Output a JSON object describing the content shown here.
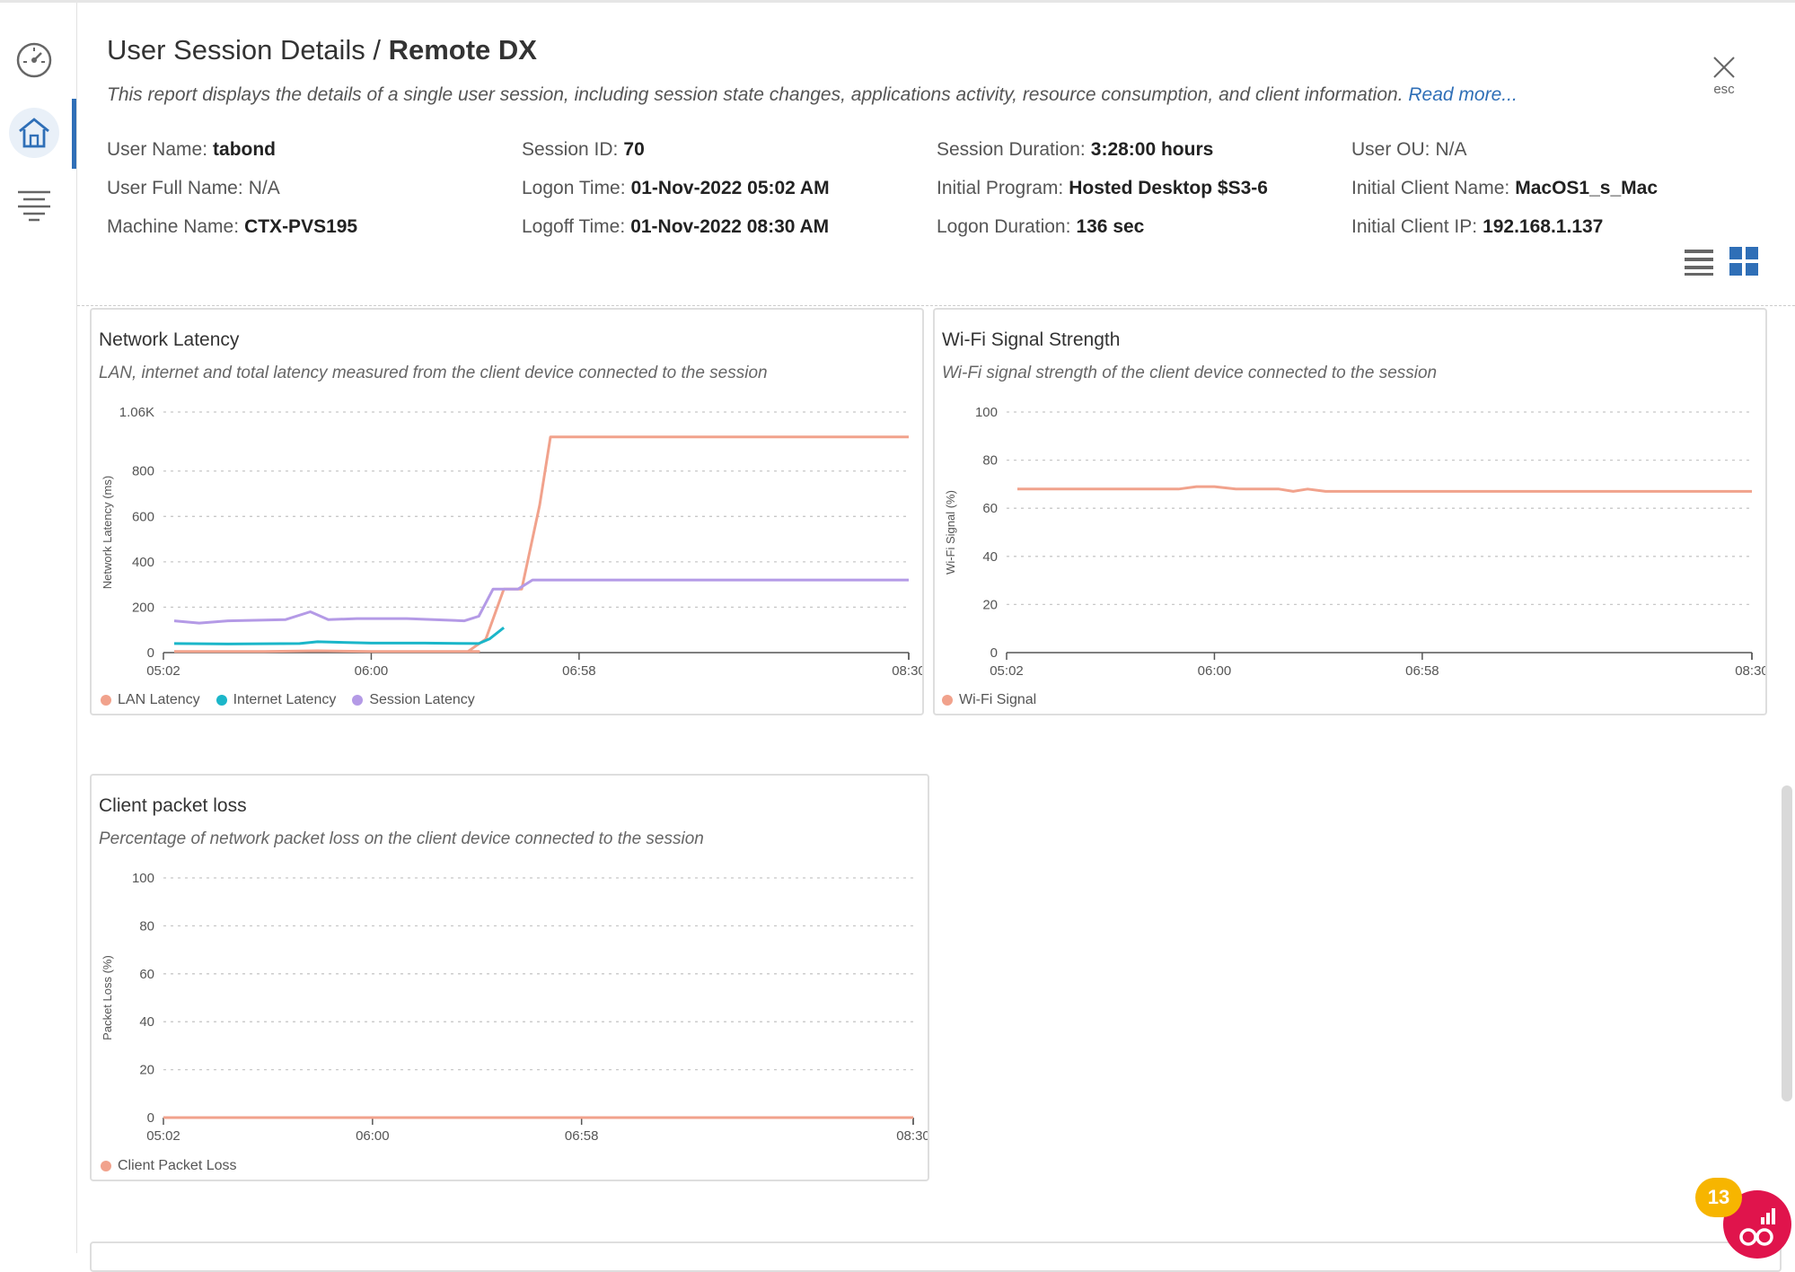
{
  "header": {
    "title_prefix": "User Session Details / ",
    "title_main": "Remote DX",
    "description": "This report displays the details of a single user session, including session state changes, applications activity, resource consumption, and client information.",
    "read_more": "Read more...",
    "close_label": "esc"
  },
  "session_info": [
    {
      "label": "User Name:",
      "value": "tabond"
    },
    {
      "label": "Session ID:",
      "value": "70"
    },
    {
      "label": "Session Duration:",
      "value": "3:28:00 hours"
    },
    {
      "label": "User OU:",
      "value": "N/A"
    },
    {
      "label": "User Full Name:",
      "value": "N/A"
    },
    {
      "label": "Logon Time:",
      "value": "01-Nov-2022 05:02 AM"
    },
    {
      "label": "Initial Program:",
      "value": "Hosted Desktop $S3-6"
    },
    {
      "label": "Initial Client Name:",
      "value": "MacOS1_s_Mac"
    },
    {
      "label": "Machine Name:",
      "value": "CTX-PVS195"
    },
    {
      "label": "Logoff Time:",
      "value": "01-Nov-2022 08:30 AM"
    },
    {
      "label": "Logon Duration:",
      "value": "136 sec"
    },
    {
      "label": "Initial Client IP:",
      "value": "192.168.1.137"
    }
  ],
  "sidebar": {
    "icons": [
      "dashboard-icon",
      "home-icon",
      "filter-list-icon"
    ],
    "active": "home-icon"
  },
  "view_toggle": {
    "icons": [
      "list-view-icon",
      "grid-view-icon"
    ],
    "active": "grid-view-icon"
  },
  "notifications": {
    "count": "13"
  },
  "colors": {
    "lan": "#f1a28c",
    "internet": "#1bb6c9",
    "session": "#b49ae6",
    "accent": "#2f6fb7",
    "badge": "#f7b500",
    "bubble": "#e0144c"
  },
  "charts": {
    "latency": {
      "title": "Network Latency",
      "subtitle": "LAN, internet and total latency measured from the client device connected to the session"
    },
    "wifi": {
      "title": "Wi-Fi Signal Strength",
      "subtitle": "Wi-Fi signal strength of the client device connected to the session"
    },
    "packet": {
      "title": "Client packet loss",
      "subtitle": "Percentage of network packet loss on the client device connected to the session"
    }
  },
  "chart_data": [
    {
      "type": "line",
      "title": "Network Latency",
      "ylabel": "Network Latency (ms)",
      "ylim": [
        0,
        1060
      ],
      "yticks": [
        0,
        200,
        400,
        600,
        800,
        1060
      ],
      "ytick_labels": [
        "0",
        "200",
        "400",
        "600",
        "800",
        "1.06K"
      ],
      "xlim": [
        302,
        510
      ],
      "xticks": [
        302,
        360,
        418,
        510
      ],
      "xtick_labels": [
        "05:02",
        "06:00",
        "06:58",
        "08:30"
      ],
      "grid": true,
      "legend": "bottom-left",
      "series": [
        {
          "name": "LAN Latency",
          "color": "#f1a28c",
          "points": [
            [
              305,
              5
            ],
            [
              330,
              5
            ],
            [
              345,
              8
            ],
            [
              360,
              5
            ],
            [
              390,
              5
            ],
            [
              387,
              5
            ],
            [
              392,
              60
            ],
            [
              397,
              280
            ],
            [
              402,
              280
            ],
            [
              407,
              650
            ],
            [
              410,
              950
            ],
            [
              510,
              950
            ]
          ]
        },
        {
          "name": "Internet Latency",
          "color": "#1bb6c9",
          "points": [
            [
              305,
              40
            ],
            [
              320,
              38
            ],
            [
              340,
              40
            ],
            [
              345,
              48
            ],
            [
              360,
              42
            ],
            [
              375,
              42
            ],
            [
              390,
              40
            ],
            [
              393,
              60
            ],
            [
              397,
              110
            ]
          ]
        },
        {
          "name": "Session Latency",
          "color": "#b49ae6",
          "points": [
            [
              305,
              140
            ],
            [
              312,
              130
            ],
            [
              320,
              140
            ],
            [
              336,
              145
            ],
            [
              343,
              180
            ],
            [
              348,
              145
            ],
            [
              356,
              150
            ],
            [
              370,
              150
            ],
            [
              386,
              140
            ],
            [
              390,
              160
            ],
            [
              394,
              280
            ],
            [
              401,
              280
            ],
            [
              405,
              320
            ],
            [
              510,
              320
            ]
          ]
        }
      ]
    },
    {
      "type": "line",
      "title": "Wi-Fi Signal Strength",
      "ylabel": "Wi-Fi Signal (%)",
      "ylim": [
        0,
        100
      ],
      "yticks": [
        0,
        20,
        40,
        60,
        80,
        100
      ],
      "ytick_labels": [
        "0",
        "20",
        "40",
        "60",
        "80",
        "100"
      ],
      "xlim": [
        302,
        510
      ],
      "xticks": [
        302,
        360,
        418,
        510
      ],
      "xtick_labels": [
        "05:02",
        "06:00",
        "06:58",
        "08:30"
      ],
      "grid": true,
      "legend": "bottom-left",
      "series": [
        {
          "name": "Wi-Fi Signal",
          "color": "#f1a28c",
          "points": [
            [
              305,
              68
            ],
            [
              350,
              68
            ],
            [
              355,
              69
            ],
            [
              360,
              69
            ],
            [
              366,
              68
            ],
            [
              378,
              68
            ],
            [
              382,
              67
            ],
            [
              386,
              68
            ],
            [
              391,
              67
            ],
            [
              510,
              67
            ]
          ]
        }
      ]
    },
    {
      "type": "line",
      "title": "Client packet loss",
      "ylabel": "Packet Loss (%)",
      "ylim": [
        0,
        100
      ],
      "yticks": [
        0,
        20,
        40,
        60,
        80,
        100
      ],
      "ytick_labels": [
        "0",
        "20",
        "40",
        "60",
        "80",
        "100"
      ],
      "xlim": [
        302,
        510
      ],
      "xticks": [
        302,
        360,
        418,
        510
      ],
      "xtick_labels": [
        "05:02",
        "06:00",
        "06:58",
        "08:30"
      ],
      "grid": true,
      "legend": "bottom-left",
      "series": [
        {
          "name": "Client Packet Loss",
          "color": "#f1a28c",
          "points": [
            [
              302,
              0
            ],
            [
              510,
              0
            ]
          ]
        }
      ]
    }
  ]
}
